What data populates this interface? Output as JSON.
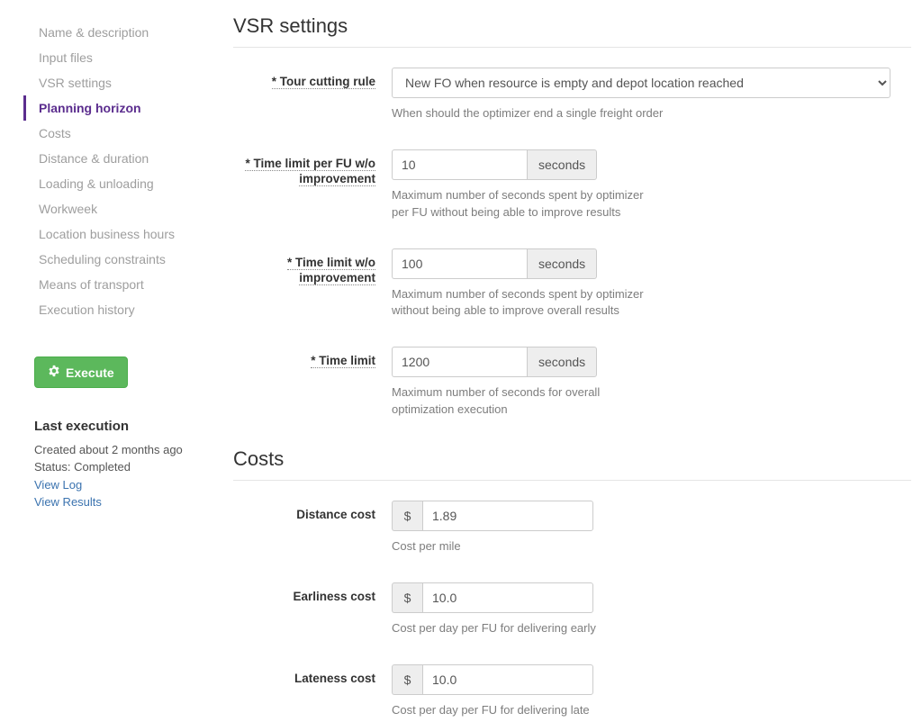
{
  "sidebar": {
    "items": [
      {
        "label": "Name & description",
        "active": false
      },
      {
        "label": "Input files",
        "active": false
      },
      {
        "label": "VSR settings",
        "active": false
      },
      {
        "label": "Planning horizon",
        "active": true
      },
      {
        "label": "Costs",
        "active": false
      },
      {
        "label": "Distance & duration",
        "active": false
      },
      {
        "label": "Loading & unloading",
        "active": false
      },
      {
        "label": "Workweek",
        "active": false
      },
      {
        "label": "Location business hours",
        "active": false
      },
      {
        "label": "Scheduling constraints",
        "active": false
      },
      {
        "label": "Means of transport",
        "active": false
      },
      {
        "label": "Execution history",
        "active": false
      }
    ],
    "execute_button": "Execute",
    "last_exec": {
      "heading": "Last execution",
      "created_line": "Created about 2 months ago",
      "status_line": "Status: Completed",
      "view_log": "View Log",
      "view_results": "View Results"
    }
  },
  "sections": {
    "vsr": {
      "heading": "VSR settings",
      "tour_cutting": {
        "label": "* Tour cutting rule",
        "value": "New FO when resource is empty and depot location reached",
        "help": "When should the optimizer end a single freight order"
      },
      "time_limit_fu": {
        "label": "* Time limit per FU w/o improvement",
        "value": "10",
        "unit": "seconds",
        "help": "Maximum number of seconds spent by optimizer per FU without being able to improve results"
      },
      "time_limit_no_improve": {
        "label": "* Time limit w/o improvement",
        "value": "100",
        "unit": "seconds",
        "help": "Maximum number of seconds spent by optimizer without being able to improve overall results"
      },
      "time_limit": {
        "label": "* Time limit",
        "value": "1200",
        "unit": "seconds",
        "help": "Maximum number of seconds for overall optimization execution"
      }
    },
    "costs": {
      "heading": "Costs",
      "distance": {
        "label": "Distance cost",
        "currency": "$",
        "value": "1.89",
        "help": "Cost per mile"
      },
      "earliness": {
        "label": "Earliness cost",
        "currency": "$",
        "value": "10.0",
        "help": "Cost per day per FU for delivering early"
      },
      "lateness": {
        "label": "Lateness cost",
        "currency": "$",
        "value": "10.0",
        "help": "Cost per day per FU for delivering late"
      }
    }
  }
}
